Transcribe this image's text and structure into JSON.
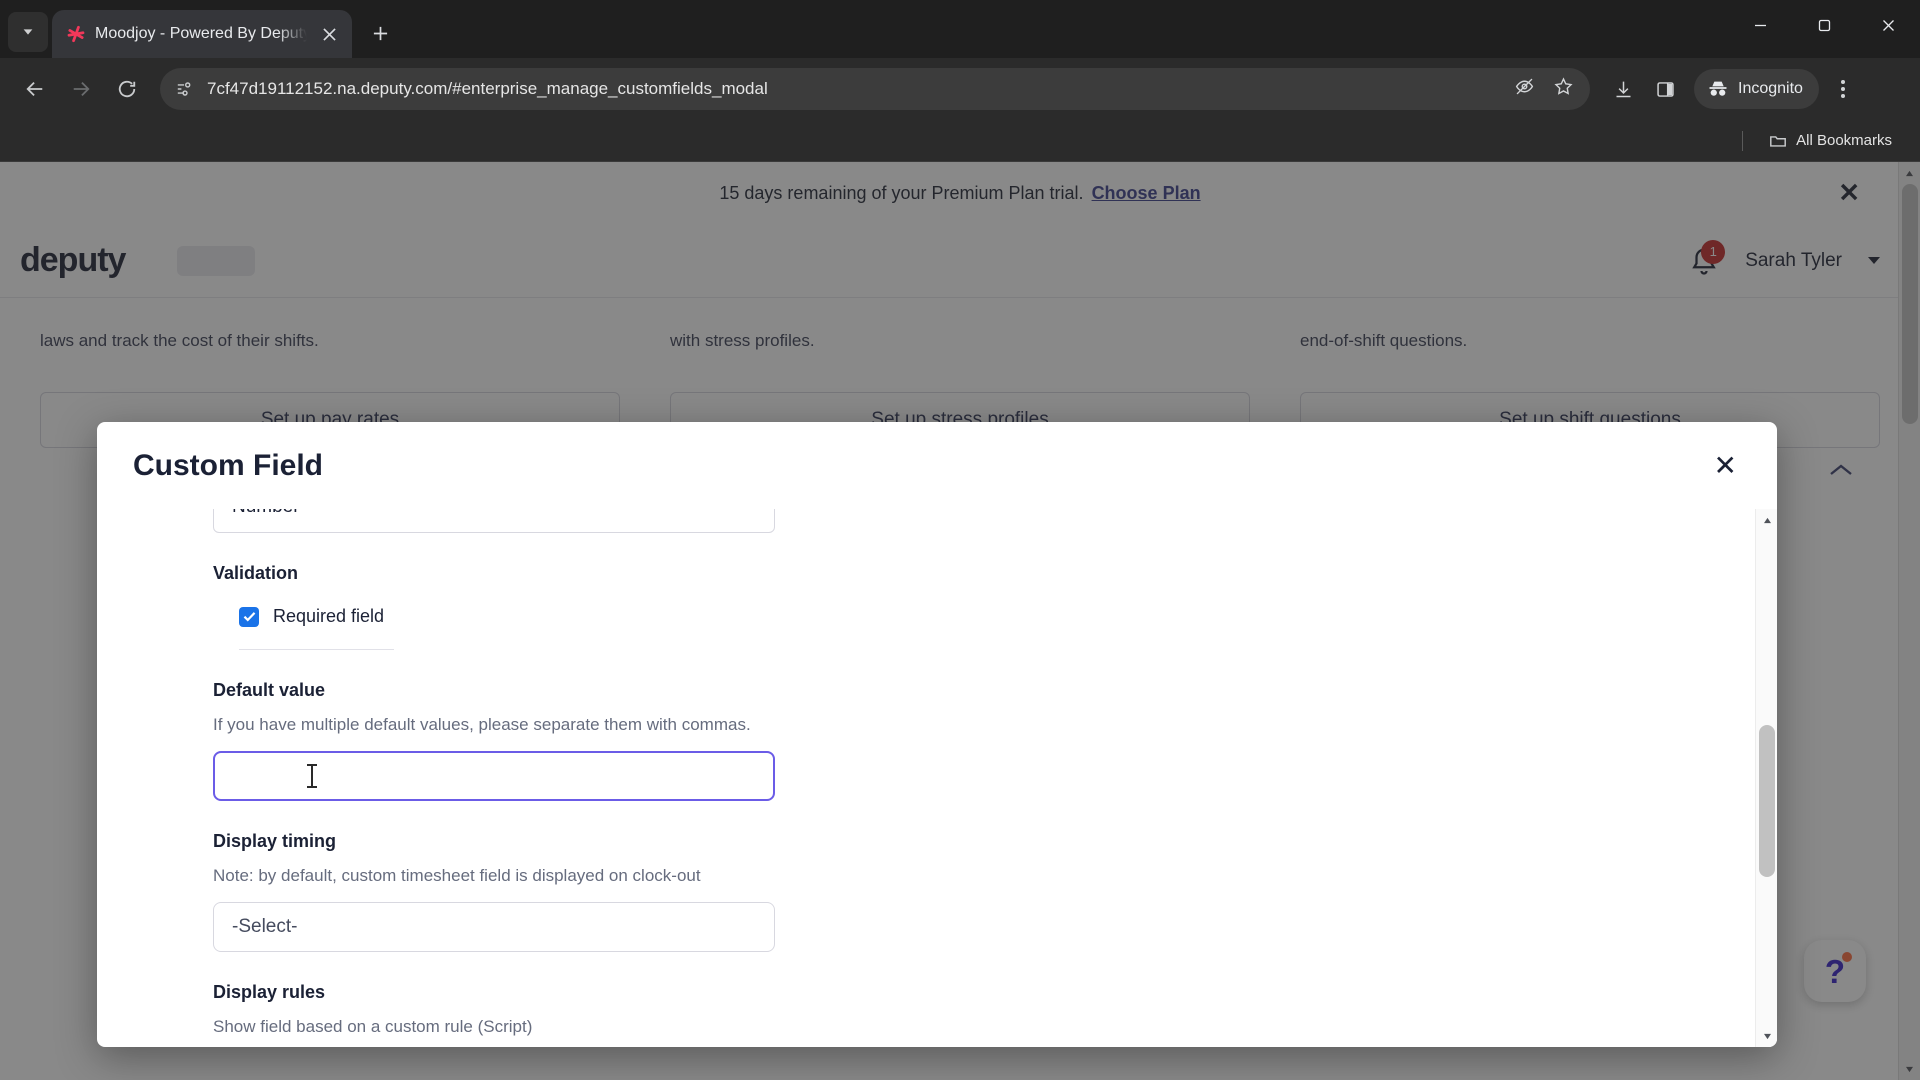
{
  "browser": {
    "tab": {
      "title": "Moodjoy - Powered By Deputy",
      "favicon_name": "moodjoy-favicon"
    },
    "new_tab_label": "+",
    "url": "7cf47d19112152.na.deputy.com/#enterprise_manage_customfields_modal",
    "profile_label": "Incognito",
    "bookmarks_label": "All Bookmarks",
    "icons": {
      "tab_search": "tab-search-icon",
      "back": "back-arrow-icon",
      "forward": "forward-arrow-icon",
      "reload": "reload-icon",
      "site_info": "site-settings-icon",
      "tracking_protection": "eye-slash-icon",
      "bookmark": "star-icon",
      "downloads": "download-icon",
      "side_panel": "side-panel-icon",
      "incognito": "incognito-hat-icon",
      "menu": "kebab-menu-icon",
      "minimize": "minimize-icon",
      "maximize": "maximize-icon",
      "close_window": "window-close-icon"
    }
  },
  "page": {
    "trial_banner": {
      "message": "15 days remaining of your Premium Plan trial.",
      "cta": "Choose Plan",
      "close": "✕"
    },
    "header": {
      "logo": "deputy",
      "notification_count": "1",
      "username": "Sarah Tyler"
    },
    "cards": [
      {
        "desc": "laws and track the cost of their shifts.",
        "button": "Set up pay rates"
      },
      {
        "desc": "with stress profiles.",
        "button": "Set up stress profiles"
      },
      {
        "desc": "end-of-shift questions.",
        "button": "Set up shift questions"
      }
    ],
    "pager": {
      "prev": "‹",
      "next": "›"
    },
    "help": {
      "glyph": "?",
      "badge": ""
    }
  },
  "modal": {
    "title": "Custom Field",
    "close": "✕",
    "clipped_field_value": "Number",
    "validation": {
      "label": "Validation",
      "checkbox_label": "Required field",
      "checked": true
    },
    "default_value": {
      "label": "Default value",
      "note": "If you have multiple default values, please separate them with commas.",
      "value": "",
      "focused": true
    },
    "display_timing": {
      "label": "Display timing",
      "note": "Note: by default, custom timesheet field is displayed on clock-out",
      "value": "-Select-"
    },
    "display_rules": {
      "label": "Display rules",
      "note": "Show field based on a custom rule (Script)"
    }
  },
  "colors": {
    "focus_purple": "#6b5ce7",
    "checkbox_blue": "#1a73e8",
    "link_indigo": "#3b3f8c",
    "badge_red": "#c62828",
    "help_purple": "#3520c9",
    "help_badge_orange": "#ff6a3d"
  }
}
